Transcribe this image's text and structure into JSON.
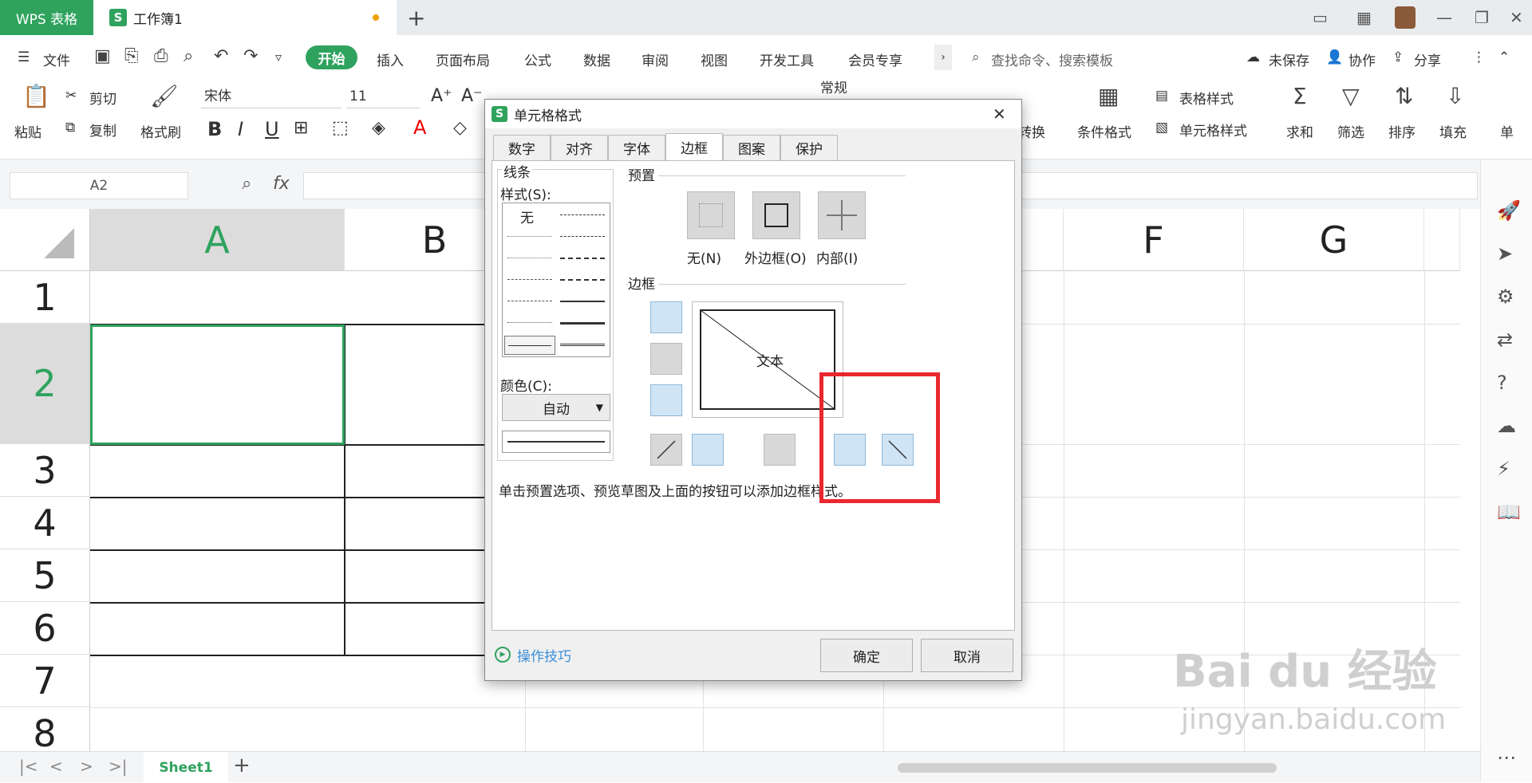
{
  "titlebar": {
    "app_tab": "WPS 表格",
    "doc_tab": "工作簿1",
    "new_tab": "+"
  },
  "menubar": {
    "file": "文件",
    "tabs": [
      "开始",
      "插入",
      "页面布局",
      "公式",
      "数据",
      "审阅",
      "视图",
      "开发工具",
      "会员专享"
    ],
    "search_placeholder": "查找命令、搜索模板",
    "unsaved": "未保存",
    "collab": "协作",
    "share": "分享"
  },
  "ribbon": {
    "paste": "粘贴",
    "cut": "剪切",
    "copy": "复制",
    "format_painter": "格式刷",
    "font_name": "宋体",
    "font_size": "11",
    "number_format": "常规",
    "convert": "转换",
    "cond_format": "条件格式",
    "table_style": "表格样式",
    "cell_style": "单元格样式",
    "sum": "求和",
    "filter": "筛选",
    "sort": "排序",
    "fill": "填充",
    "single": "单"
  },
  "formulabar": {
    "name_box": "A2",
    "fx": "fx"
  },
  "grid": {
    "columns": [
      "A",
      "B",
      "F",
      "G"
    ],
    "rows": [
      "1",
      "2",
      "3",
      "4",
      "5",
      "6",
      "7",
      "8"
    ]
  },
  "sheets": {
    "active": "Sheet1",
    "add": "+"
  },
  "dialog": {
    "title": "单元格格式",
    "tabs": [
      "数字",
      "对齐",
      "字体",
      "边框",
      "图案",
      "保护"
    ],
    "active_tab": "边框",
    "line_group": "线条",
    "style_label": "样式(S):",
    "style_none": "无",
    "color_label": "颜色(C):",
    "color_value": "自动",
    "preset_group": "预置",
    "preset_none": "无(N)",
    "preset_outline": "外边框(O)",
    "preset_inside": "内部(I)",
    "border_group": "边框",
    "preview_text": "文本",
    "hint": "单击预置选项、预览草图及上面的按钮可以添加边框样式。",
    "tips": "操作技巧",
    "ok": "确定",
    "cancel": "取消"
  },
  "watermark": {
    "brand": "Bai du 经验",
    "url": "jingyan.baidu.com"
  },
  "colors": {
    "accent": "#2fa35e",
    "highlight": "#e8282e"
  }
}
